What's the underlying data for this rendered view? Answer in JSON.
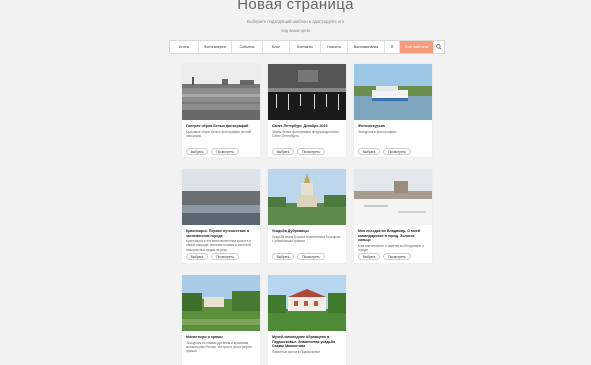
{
  "page": {
    "title": "Новая страница",
    "subtitle": "Выберите подходящий шаблон и адаптируйте его под ваши цели"
  },
  "filters": {
    "items": [
      "Блоги",
      "Фотогалереи",
      "События",
      "Блог",
      "Контакты",
      "Новости",
      "Воспоминания",
      "Я",
      "Мои шаблоны"
    ],
    "active_index": 8
  },
  "accent_color": "#f59b7c",
  "cards": [
    {
      "title": "Галерея чёрно-белых фотографий",
      "desc": "Красивые чёрно-белые фотографии речной панорамы",
      "choose": "Выбрать",
      "preview": "Посмотреть"
    },
    {
      "title": "Санкт-Петербург. Декабрь 2019",
      "desc": "Чёрно-белые фотографии предпраздничного Санкт-Петербурга",
      "choose": "Выбрать",
      "preview": "Посмотреть"
    },
    {
      "title": "Фотоэкскурсия",
      "desc": "Экскурсия в фотографиях",
      "choose": "Выбрать",
      "preview": "Посмотреть"
    },
    {
      "title": "Красноярск. Первое путешествие в заснеженном городе",
      "desc": "Красноярск и его величественная красота в самой природе, мягкими ночами и чистотой невероятных видов на реку",
      "choose": "Выбрать",
      "preview": "Посмотреть"
    },
    {
      "title": "Усадьба Дубровицы",
      "desc": "Усадьба князя Бориса Алексеевича Голицына с уникальным храмом",
      "choose": "Выбрать",
      "preview": "Посмотреть"
    },
    {
      "title": "Моя поездка во Владимир. О моей командировке в город. Золотое кольцо",
      "desc": "Моя впечатления и заметки во Владимире о городе",
      "choose": "Выбрать",
      "preview": "Посмотреть"
    },
    {
      "title": "Монастыри и храмы",
      "desc": "Экскурсия по самым древним и красивым монастырям России, история и фотографии храмов",
      "choose": "Выбрать",
      "preview": "Посмотреть"
    },
    {
      "title": "Музей-заповедник Абрамцево в Подмосковье. Знаменитая усадьба Саввы Мамонтова",
      "desc": "Памятные места в Подмосковье",
      "choose": "Выбрать",
      "preview": "Посмотреть"
    }
  ]
}
